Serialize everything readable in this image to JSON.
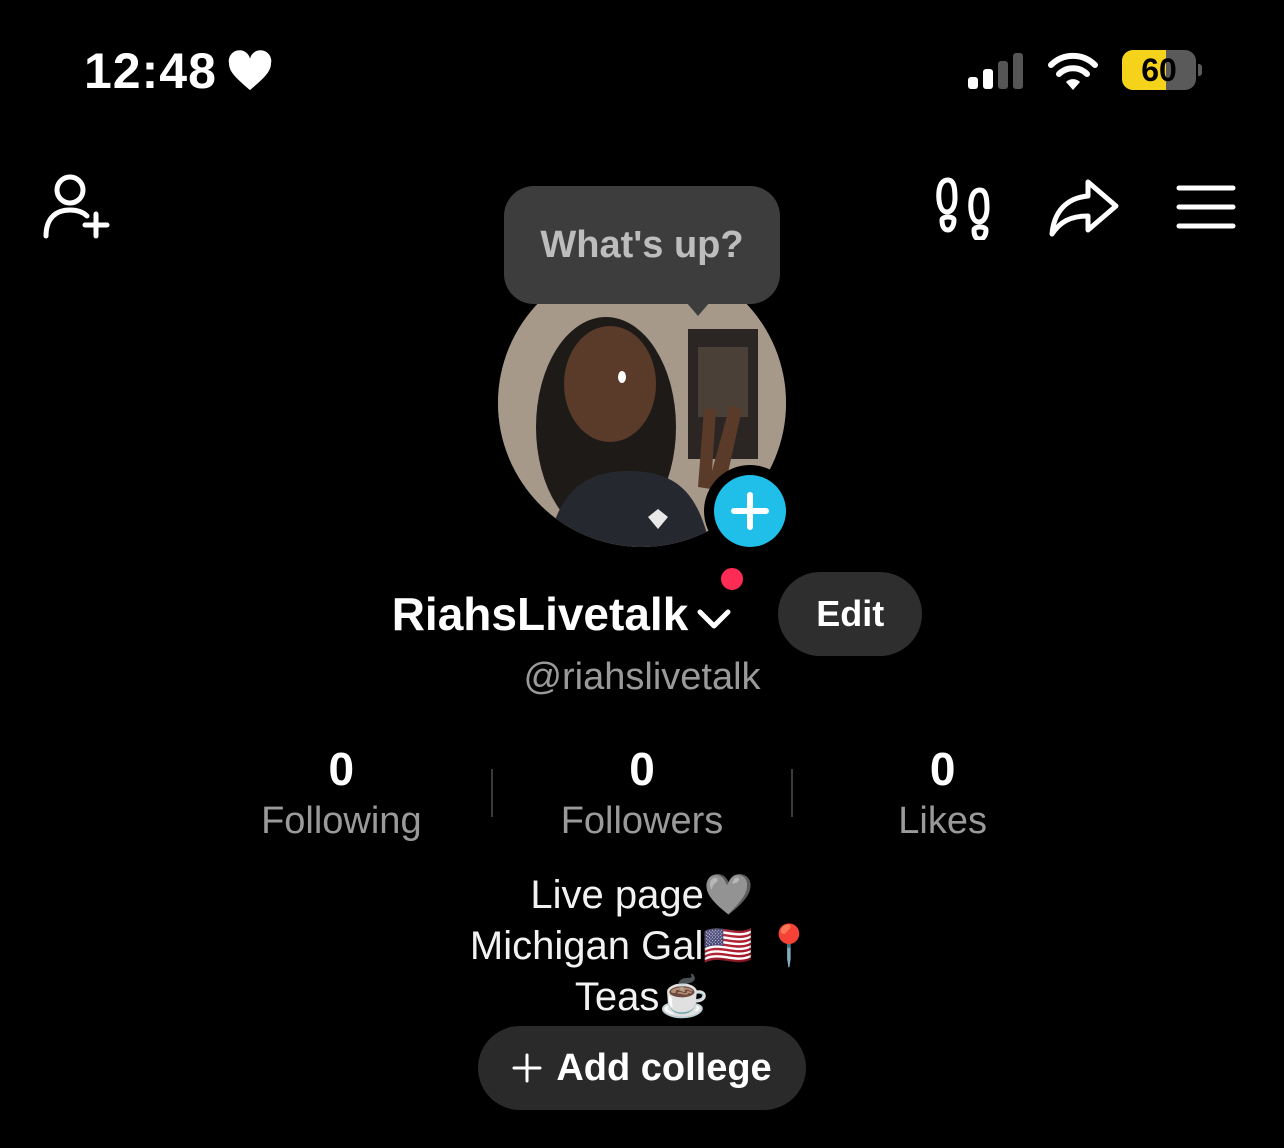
{
  "status_bar": {
    "time": "12:48",
    "battery": "60",
    "icons": [
      "heart-icon",
      "signal-icon",
      "wifi-icon",
      "battery-icon"
    ]
  },
  "bubble": {
    "text": "What's up?"
  },
  "profile": {
    "display_name": "RiahsLivetalk",
    "handle": "@riahslivetalk",
    "edit_label": "Edit"
  },
  "stats": [
    {
      "value": "0",
      "label": "Following"
    },
    {
      "value": "0",
      "label": "Followers"
    },
    {
      "value": "0",
      "label": "Likes"
    }
  ],
  "bio": {
    "line1": "Live page🩶",
    "line2": "Michigan Gal🇺🇸 📍",
    "line3": "Teas☕️"
  },
  "add_college": {
    "label": "Add college"
  },
  "colors": {
    "background": "#000000",
    "accent_plus": "#20bfe9",
    "notification_dot": "#fe2c55",
    "battery_fill": "#f5d31b"
  }
}
